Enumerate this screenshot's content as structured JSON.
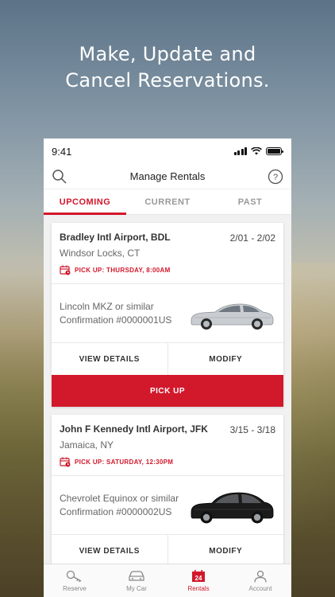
{
  "headline": {
    "line1": "Make, Update and",
    "line2": "Cancel Reservations."
  },
  "status_bar": {
    "time": "9:41"
  },
  "nav": {
    "title": "Manage Rentals"
  },
  "tabs": [
    {
      "label": "UPCOMING",
      "active": true
    },
    {
      "label": "CURRENT",
      "active": false
    },
    {
      "label": "PAST",
      "active": false
    }
  ],
  "reservations": [
    {
      "location": "Bradley Intl Airport, BDL",
      "dates": "2/01 - 2/02",
      "city": "Windsor Locks, CT",
      "pickup": "PICK UP: THURSDAY, 8:00AM",
      "car": "Lincoln MKZ or similar",
      "confirmation": "Confirmation #0000001US",
      "car_color": "#c9cdd1",
      "view_details": "VIEW DETAILS",
      "modify": "MODIFY",
      "pick_up_button": "PICK UP"
    },
    {
      "location": "John F Kennedy Intl Airport, JFK",
      "dates": "3/15 - 3/18",
      "city": "Jamaica, NY",
      "pickup": "PICK UP: SATURDAY, 12:30PM",
      "car": "Chevrolet Equinox or similar",
      "confirmation": "Confirmation #0000002US",
      "car_color": "#1b1b1b",
      "view_details": "VIEW DETAILS",
      "modify": "MODIFY"
    }
  ],
  "bottom_nav": [
    {
      "label": "Reserve",
      "icon": "key-icon"
    },
    {
      "label": "My Car",
      "icon": "car-icon"
    },
    {
      "label": "Rentals",
      "icon": "calendar-icon",
      "badge": "24",
      "active": true
    },
    {
      "label": "Account",
      "icon": "person-icon"
    }
  ],
  "colors": {
    "accent": "#d2182b"
  }
}
